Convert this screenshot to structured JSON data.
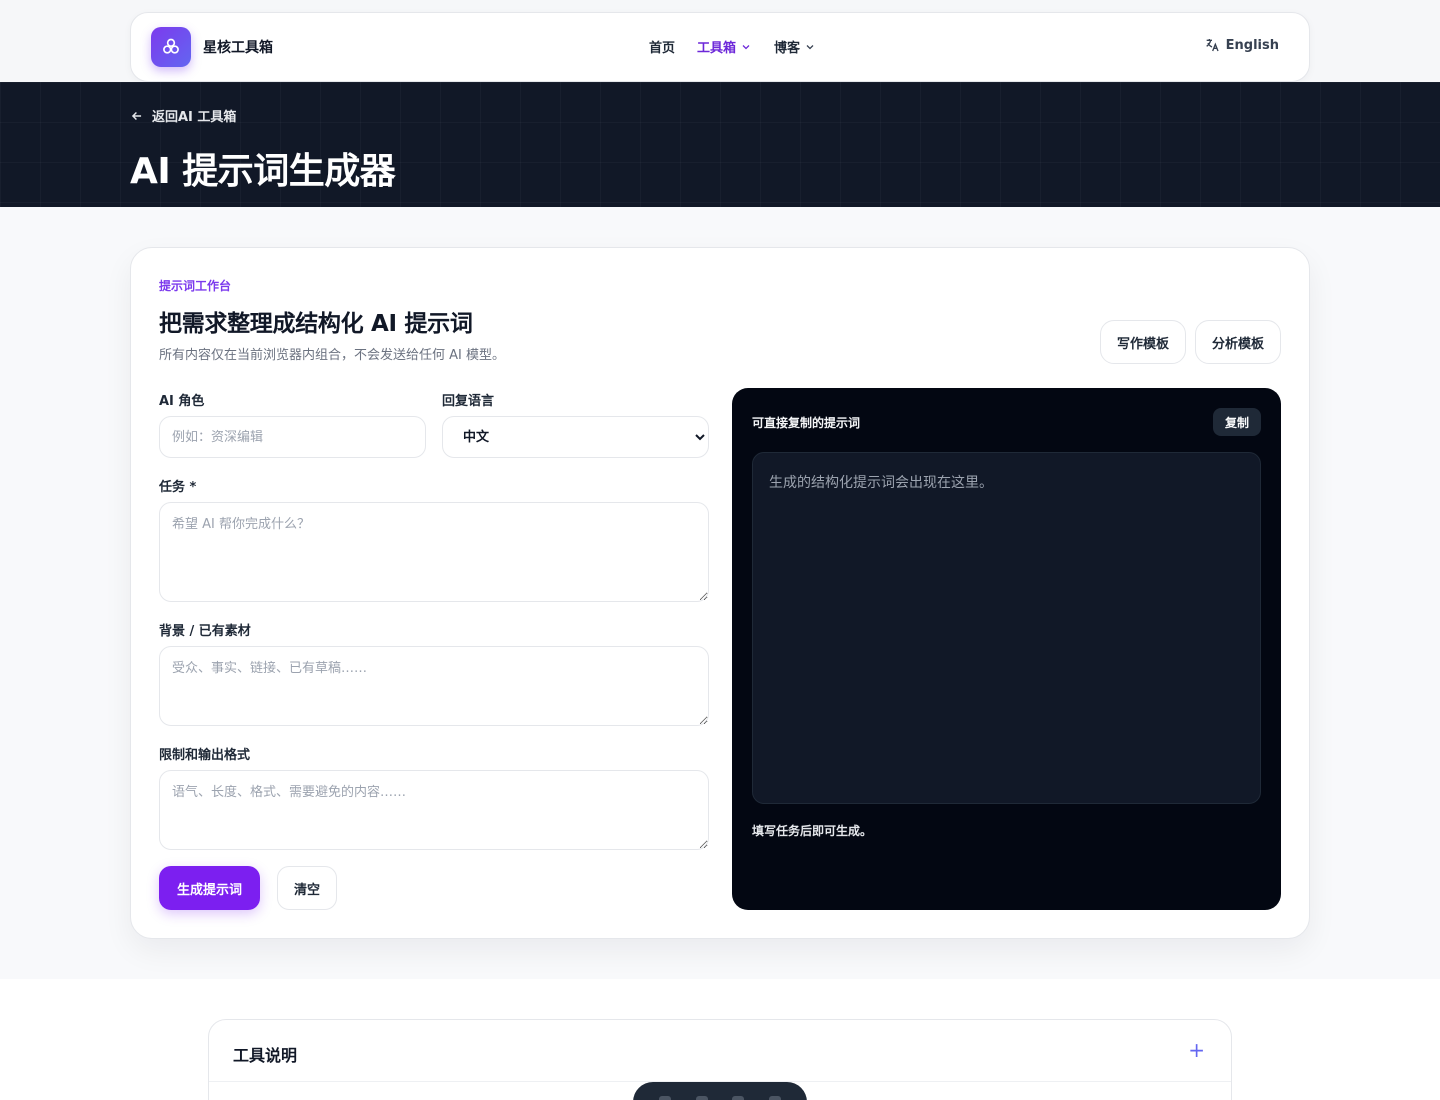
{
  "nav": {
    "brand": "星核工具箱",
    "links": [
      {
        "label": "首页"
      },
      {
        "label": "工具箱"
      },
      {
        "label": "博客"
      }
    ],
    "language": "English"
  },
  "hero": {
    "back_label": "返回AI 工具箱",
    "title": "AI 提示词生成器"
  },
  "workbench": {
    "eyebrow": "提示词工作台",
    "title": "把需求整理成结构化 AI 提示词",
    "subtitle": "所有内容仅在当前浏览器内组合，不会发送给任何 AI 模型。",
    "templates": [
      "写作模板",
      "分析模板"
    ],
    "form": {
      "role_label": "AI 角色",
      "role_placeholder": "例如：资深编辑",
      "language_label": "回复语言",
      "language_value": "中文",
      "task_label": "任务 *",
      "task_placeholder": "希望 AI 帮你完成什么？",
      "context_label": "背景 / 已有素材",
      "context_placeholder": "受众、事实、链接、已有草稿……",
      "constraints_label": "限制和输出格式",
      "constraints_placeholder": "语气、长度、格式、需要避免的内容……",
      "generate_label": "生成提示词",
      "clear_label": "清空"
    },
    "output": {
      "title": "可直接复制的提示词",
      "copy_label": "复制",
      "placeholder": "生成的结构化提示词会出现在这里。",
      "hint": "填写任务后即可生成。"
    }
  },
  "info": {
    "title": "工具说明",
    "toggle": "+"
  },
  "colors": {
    "accent": "#7c3aed",
    "hero_bg": "#111827",
    "output_bg": "#030712"
  }
}
